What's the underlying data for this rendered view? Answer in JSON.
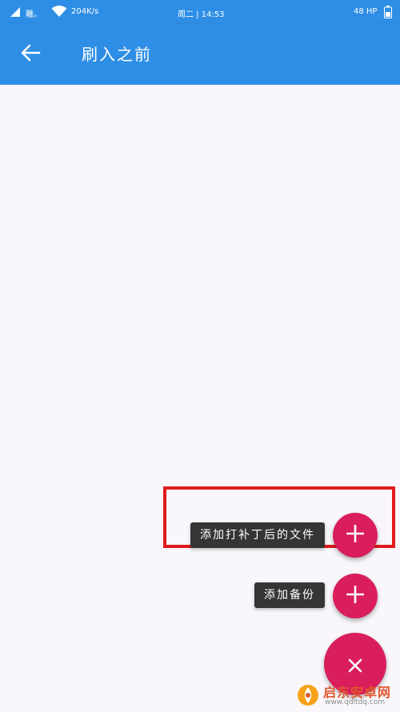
{
  "status_bar": {
    "carrier": "雕。",
    "speed": "204K/s",
    "datetime": "周二 | 14:53",
    "battery": "48 HP"
  },
  "app_bar": {
    "title": "刷入之前",
    "back_icon": "arrow-left-icon"
  },
  "fab_menu": {
    "items": [
      {
        "label": "添加打补丁后的文件",
        "icon": "plus-icon"
      },
      {
        "label": "添加备份",
        "icon": "plus-icon"
      }
    ],
    "main_icon": "close-icon"
  },
  "watermark": {
    "name": "启东安卓网",
    "url": "www.qdltdq.com"
  },
  "colors": {
    "primary": "#2e8ee6",
    "accent": "#d91e5b",
    "chip": "#353535",
    "highlight": "#e01b1b",
    "background": "#f9f7fb"
  }
}
